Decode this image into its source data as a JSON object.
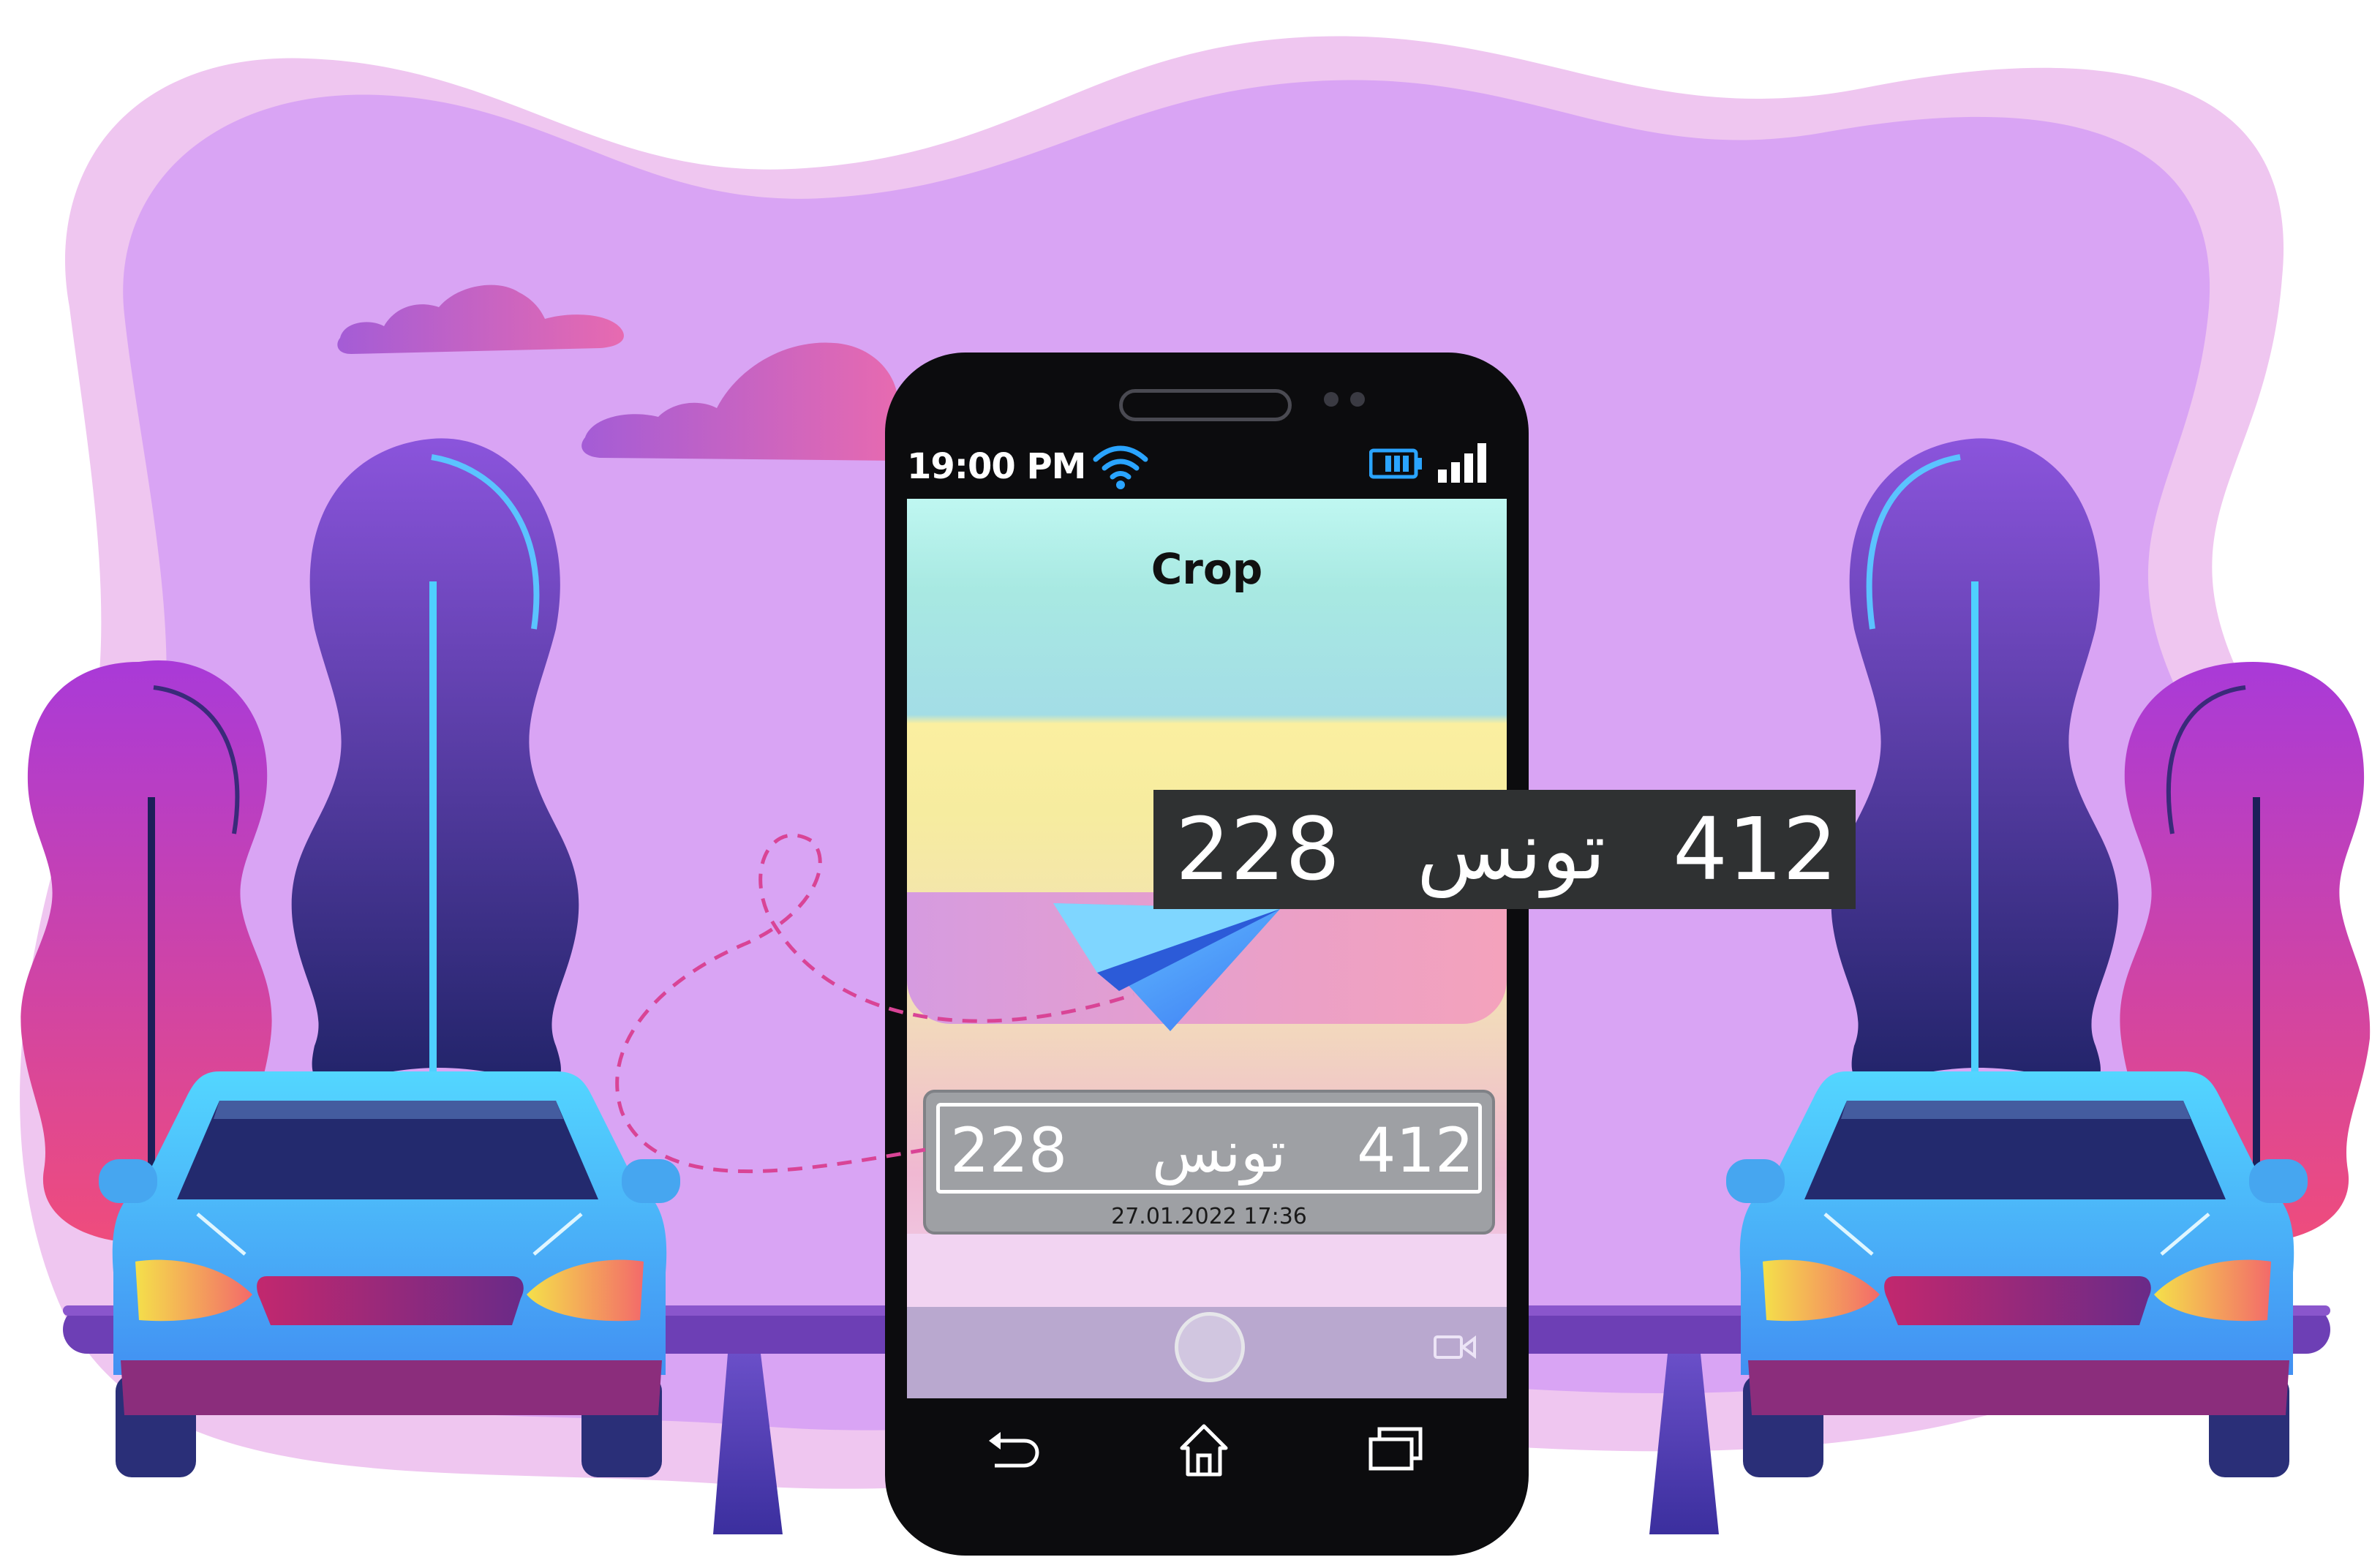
{
  "colors": {
    "blob_outer": "#efc6f0",
    "blob_inner": "#d9a4f4",
    "phone_body": "#0c0c0e",
    "screen_teal": "#a6e6e4",
    "screen_yellow": "#f8ec9f",
    "plate_grey": "#9ea0a4",
    "result_plate_bg": "#2f3132",
    "car_body": "#4fc1ff",
    "tree_top": "#8b4fd8",
    "tree_bottom": "#24266a"
  },
  "status_bar": {
    "time": "19:00 PM",
    "wifi_icon": "wifi-icon",
    "battery_icon": "battery-icon",
    "signal_icon": "signal-icon"
  },
  "screen": {
    "title": "Crop",
    "plate": {
      "left_number": "228",
      "arabic": "تونس",
      "right_number": "412",
      "timestamp": "27.01.2022 17:36"
    },
    "home_icon": "home-button-icon",
    "video_icon": "video-camera-icon"
  },
  "nav_bar": {
    "back_icon": "back-icon",
    "home_icon": "home-icon",
    "recents_icon": "recent-apps-icon"
  },
  "recognized_plate": {
    "left_number": "228",
    "arabic": "تونس",
    "right_number": "412"
  },
  "decor": {
    "plane_icon": "paper-plane-icon",
    "car_icon": "car-icon",
    "tree_icon": "tree-icon",
    "cloud_icon": "cloud-icon"
  }
}
